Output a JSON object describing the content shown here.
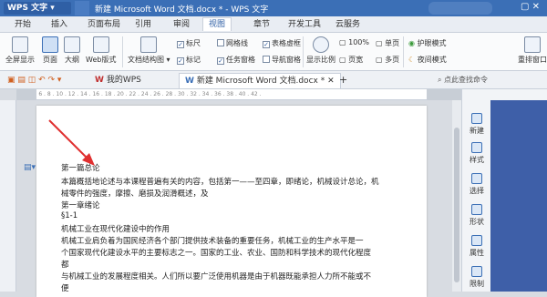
{
  "titlebar": {
    "app_name": "WPS 文字",
    "document_title": "新建 Microsoft Word 文档.docx * - WPS 文字"
  },
  "menu_tabs": [
    "开始",
    "插入",
    "页面布局",
    "引用",
    "审阅",
    "视图",
    "章节",
    "开发工具",
    "云服务"
  ],
  "ribbon": {
    "full_display": "全屏显示",
    "page": "页面",
    "outline": "大纲",
    "web_layout": "Web版式",
    "doc_structure": "文档结构图",
    "ruler": "标尺",
    "gridlines": "网格线",
    "table_guides": "表格虚框",
    "markup": "标记",
    "task_pane": "任务窗格",
    "nav_pane": "导航窗格",
    "zoom": "显示比例",
    "hundred_percent": "100%",
    "single_page": "单页",
    "page_width": "页宽",
    "multi_page": "多页",
    "eye_protect": "护眼模式",
    "night_mode": "夜间模式",
    "rearrange": "重排窗口"
  },
  "doc_tabs": {
    "my_wps": "我的WPS",
    "current_doc": "新建 Microsoft Word 文档.docx *",
    "new_tab": "+"
  },
  "search_placeholder": "点此查找命令",
  "ruler_text": "L  2 . 4 . 6 . 8 . 10 . 12 . 14 . 16 . 18 . 20 . 22 . 24 . 26 . 28 . 30 . 32 . 34 . 36 . 38 . 40 . 42 .",
  "document_lines": [
    "第一篇总论",
    "本篇概括地论述与本课程普遍有关的内容，包括第一——至四章，即绪论，机械设计总论，机",
    "械零件的强度，摩擦、磨损及润滑概述，及",
    "第一章绪论",
    "§1-1",
    "机械工业在现代化建设中的作用",
    "机械工业肩负着为国民经济各个部门提供技术装备的重要任务，机械工业的生产水平是一",
    "个国家现代化建设水平的主要标志之一。国家的工业、农业、国防和科学技术的现代化程度",
    "都",
    "与机械工业的发展程度相关。人们所以要广泛使用机器是由于机器既能承担人力所不能或不",
    "便"
  ],
  "sidebar_items": [
    "新建",
    "样式",
    "选择",
    "形状",
    "属性",
    "限制"
  ],
  "colors": {
    "titlebar": "#3b6fb6",
    "accent": "#2f5fa5",
    "arrow": "#e03030"
  }
}
